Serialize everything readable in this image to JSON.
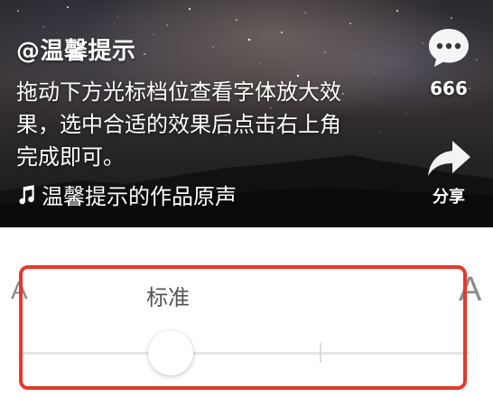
{
  "preview": {
    "author": "@温馨提示",
    "caption": "拖动下方光标档位查看字体放大效果，选中合适的效果后点击右上角完成即可。",
    "music_title": "温馨提示的作品原声",
    "comment_count": "666",
    "share_label": "分享",
    "icons": {
      "comment": "comment-bubble-icon",
      "share": "share-arrow-icon",
      "music": "music-note-icon"
    }
  },
  "font_slider": {
    "small_a": "A",
    "large_a": "A",
    "current_level_label": "标准",
    "highlight_color": "#e23a2b"
  }
}
